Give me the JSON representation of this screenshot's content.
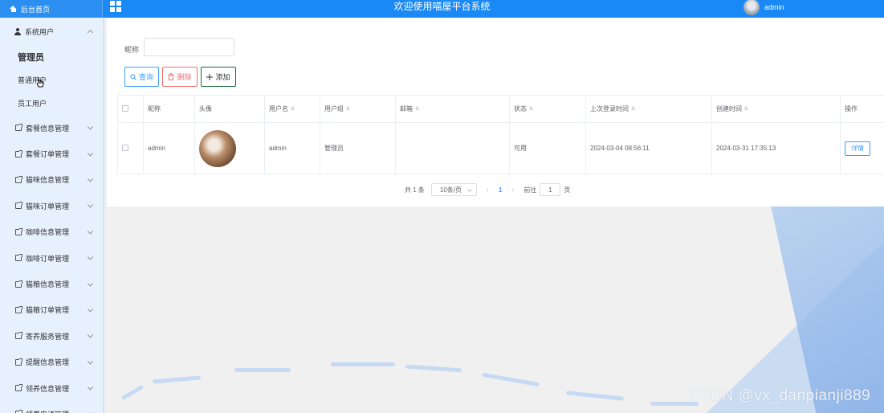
{
  "header": {
    "home_label": "后台首页",
    "app_title": "欢迎使用喵屋平台系统",
    "username": "admin"
  },
  "sidebar": {
    "system_user": "系统用户",
    "sub_items": [
      "管理员",
      "普通用户",
      "员工用户"
    ],
    "items": [
      "套餐信息管理",
      "套餐订单管理",
      "猫咪信息管理",
      "猫咪订单管理",
      "咖啡信息管理",
      "咖啡订单管理",
      "猫粮信息管理",
      "猫粮订单管理",
      "寄养服务管理",
      "提醒信息管理",
      "领养信息管理",
      "领养申请管理"
    ]
  },
  "search": {
    "nickname_label": "昵称",
    "nickname_value": ""
  },
  "toolbar": {
    "query_label": "查询",
    "delete_label": "删除",
    "add_label": "添加"
  },
  "table": {
    "headers": [
      "昵称",
      "头像",
      "用户名",
      "用户组",
      "邮箱",
      "状态",
      "上次登录时间",
      "创建时间",
      "操作"
    ],
    "rows": [
      {
        "nickname": "admin",
        "username": "admin",
        "group": "管理员",
        "email": "",
        "status": "可用",
        "last_login": "2024-03-04 08:56:11",
        "created": "2024-03-31 17:35:13",
        "action": "详情"
      }
    ]
  },
  "pagination": {
    "total": "共 1 条",
    "page_size": "10条/页",
    "current_page": "1",
    "goto_prefix": "前往",
    "goto_value": "1",
    "goto_suffix": "页"
  },
  "watermark": "CSDN @vx_danpianji889"
}
